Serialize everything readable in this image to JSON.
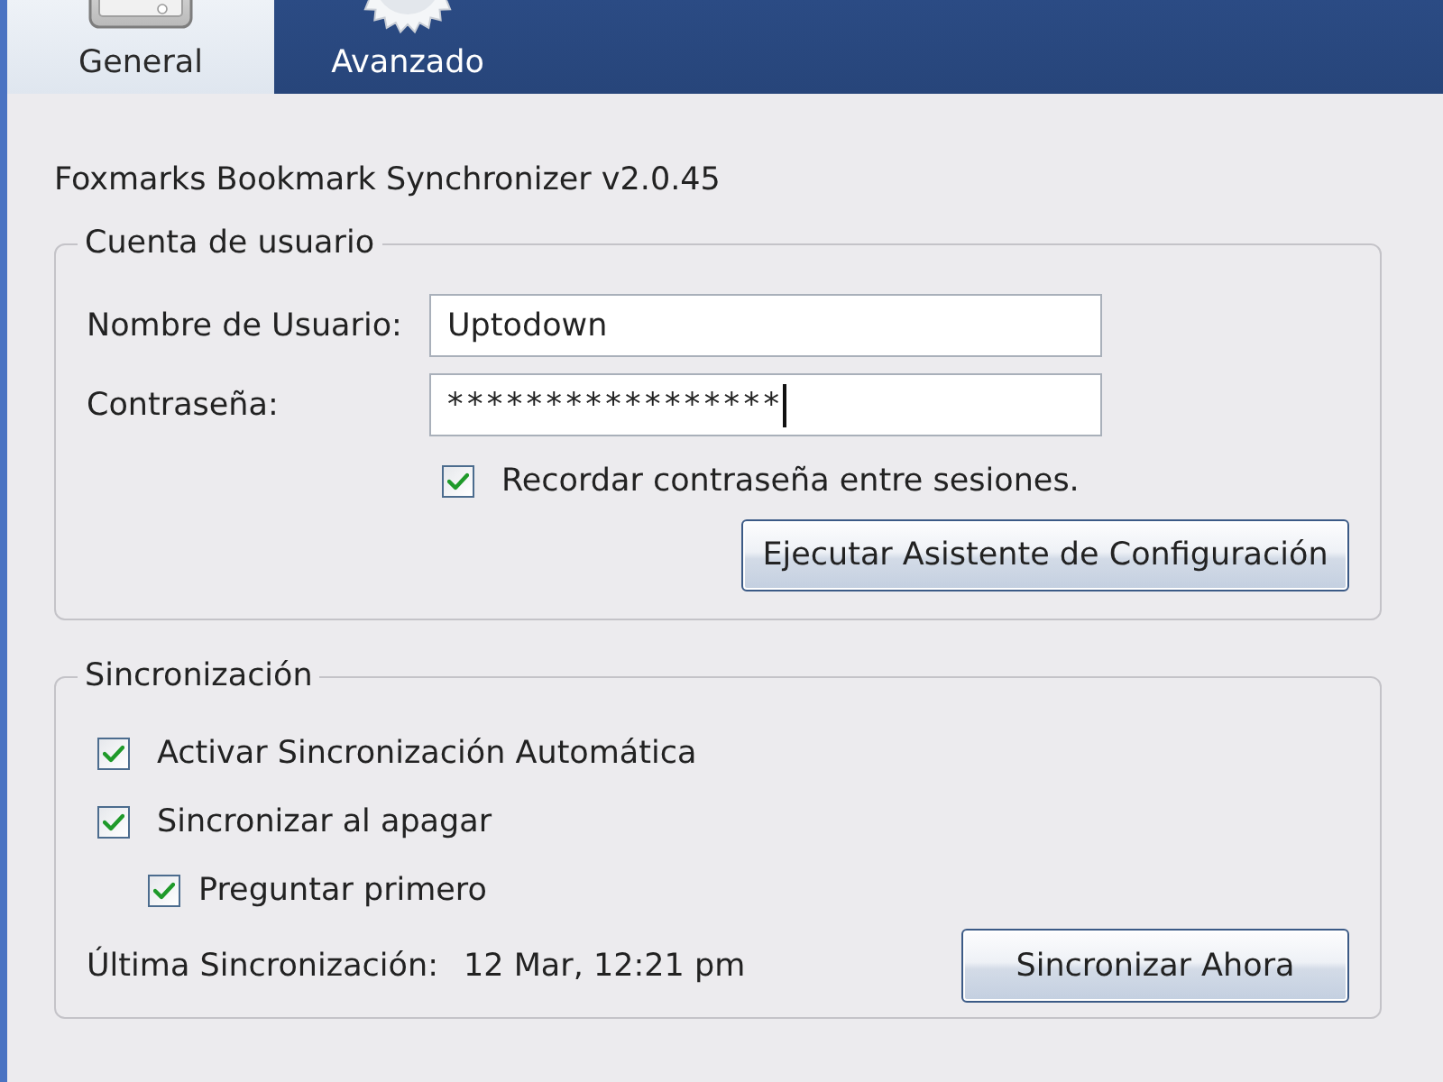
{
  "tabs": [
    {
      "label": "General",
      "selected": true,
      "kind": "general"
    },
    {
      "label": "Avanzado",
      "selected": false,
      "kind": "advanced"
    }
  ],
  "heading": "Foxmarks Bookmark Synchronizer v2.0.45",
  "account": {
    "title": "Cuenta de usuario",
    "username": {
      "label": "Nombre de Usuario:",
      "value": "Uptodown"
    },
    "password": {
      "label": "Contraseña:",
      "value": "*****************",
      "focused": true
    },
    "remember": {
      "label": "Recordar contraseña entre sesiones.",
      "checked": true
    },
    "wizard_button": "Ejecutar Asistente de Configuración"
  },
  "sync": {
    "title": "Sincronización",
    "options": [
      {
        "label": "Activar Sincronización Automática",
        "checked": true
      },
      {
        "label": "Sincronizar al apagar",
        "checked": true,
        "children": [
          {
            "label": "Preguntar primero",
            "checked": true
          }
        ]
      }
    ],
    "last_sync": {
      "label": "Última Sincronización:",
      "value": "12 Mar, 12:21 pm"
    },
    "sync_button": "Sincronizar Ahora"
  }
}
